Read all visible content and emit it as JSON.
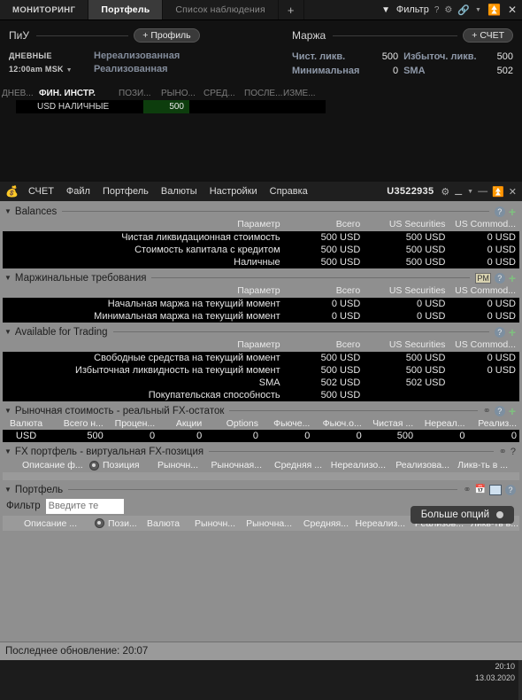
{
  "top": {
    "tabs": [
      {
        "label": "МОНИТОРИНГ",
        "state": "normal"
      },
      {
        "label": "Портфель",
        "state": "active"
      },
      {
        "label": "Список наблюдения",
        "state": "dim"
      },
      {
        "label": "+",
        "state": "plus"
      }
    ],
    "toolbar": {
      "filter_label": "Фильтр",
      "help_label": "?",
      "gear_icon": "gear-icon",
      "link_icon": "link-icon",
      "caret_icon": "chevron-down-icon",
      "expand_icon": "expand-icon",
      "close_icon": "close-icon"
    },
    "pnl": {
      "title": "ПиУ",
      "profile_button": "+ Профиль",
      "period": "ДНЕВНЫЕ",
      "period_time": "12:00am MSK",
      "rows": [
        {
          "label": "Нереализованная",
          "value": ""
        },
        {
          "label": "Реализованная",
          "value": ""
        }
      ]
    },
    "margin": {
      "title": "Маржа",
      "account_button": "+ СЧЕТ",
      "rows": [
        {
          "label_left": "Чист. ликв.",
          "value_left": "500",
          "label_right": "Избыточ. ликв.",
          "value_right": "500"
        },
        {
          "label_left": "Минимальная",
          "value_left": "0",
          "label_right": "SMA",
          "value_right": "502"
        }
      ]
    },
    "mini_grid": {
      "headers": [
        "ДНЕВ...",
        "ФИН. ИНСТР.",
        "ПОЗИ...",
        "РЫНО...",
        "СРЕД...",
        "ПОСЛЕ...",
        "ИЗМЕ..."
      ],
      "row": {
        "instrument": "USD НАЛИЧНЫЕ",
        "position": "500"
      },
      "highlight_color": "#0d3d0d"
    }
  },
  "tws": {
    "menubar": {
      "items": [
        "СЧЕТ",
        "Файл",
        "Портфель",
        "Валюты",
        "Настройки",
        "Справка"
      ],
      "account": "U3522935",
      "gear_icon": "gear-icon",
      "pin_icon": "pin-icon",
      "minimize_icon": "minimize-icon",
      "maximize_icon": "maximize-icon",
      "close_icon": "close-icon"
    },
    "sections": {
      "balances": {
        "title": "Balances",
        "columns": [
          "Параметр",
          "Всего",
          "US Securities",
          "US Commod..."
        ],
        "rows": [
          {
            "param": "Чистая ликвидационная стоимость",
            "total": "500 USD",
            "sec": "500 USD",
            "com": "0 USD"
          },
          {
            "param": "Стоимость капитала с кредитом",
            "total": "500 USD",
            "sec": "500 USD",
            "com": "0 USD"
          },
          {
            "param": "Наличные",
            "total": "500 USD",
            "sec": "500 USD",
            "com": "0 USD"
          }
        ]
      },
      "margin_req": {
        "title": "Маржинальные требования",
        "columns": [
          "Параметр",
          "Всего",
          "US Securities",
          "US Commod..."
        ],
        "rows": [
          {
            "param": "Начальная маржа на текущий момент",
            "total": "0 USD",
            "sec": "0 USD",
            "com": "0 USD"
          },
          {
            "param": "Минимальная маржа на текущий момент",
            "total": "0 USD",
            "sec": "0 USD",
            "com": "0 USD"
          }
        ]
      },
      "available": {
        "title": "Available for Trading",
        "columns": [
          "Параметр",
          "Всего",
          "US Securities",
          "US Commod..."
        ],
        "rows": [
          {
            "param": "Свободные средства на текущий момент",
            "total": "500 USD",
            "sec": "500 USD",
            "com": "0 USD"
          },
          {
            "param": "Избыточная ликвидность на текущий момент",
            "total": "500 USD",
            "sec": "500 USD",
            "com": "0 USD"
          },
          {
            "param": "SMA",
            "total": "502 USD",
            "sec": "502 USD",
            "com": ""
          },
          {
            "param": "Покупательская способность",
            "total": "500 USD",
            "sec": "",
            "com": ""
          }
        ]
      },
      "fx_real": {
        "title": "Рыночная стоимость - реальный FX-остаток",
        "columns": [
          "Валюта",
          "Всего н...",
          "Процен...",
          "Акции",
          "Options",
          "Фьюче...",
          "Фьюч.о...",
          "Чистая ...",
          "Нереал...",
          "Реализ..."
        ],
        "rows": [
          {
            "cur": "USD",
            "c1": "500",
            "c2": "0",
            "c3": "0",
            "c4": "0",
            "c5": "0",
            "c6": "0",
            "c7": "500",
            "c8": "0",
            "c9": "0"
          }
        ]
      },
      "fx_virtual": {
        "title": "FX портфель - виртуальная FX-позиция",
        "help_label": "?",
        "columns": [
          "Описание ф...",
          "Позиция",
          "Рыночн...",
          "Рыночная...",
          "Средняя ...",
          "Нереализо...",
          "Реализова...",
          "Ликв-ть в ..."
        ]
      },
      "portfolio": {
        "title": "Портфель",
        "filter_label": "Фильтр",
        "filter_value": "",
        "filter_placeholder": "Введите те",
        "more_options_button": "Больше опций",
        "columns": [
          "Описание ...",
          "Пози...",
          "Валюта",
          "Рыночн...",
          "Рыночна...",
          "Средняя...",
          "Нереализ...",
          "Реализов...",
          "Ликв-ть в..."
        ]
      }
    },
    "statusbar": {
      "text": "Последнее обновление: 20:07"
    }
  },
  "clock": {
    "time": "20:10",
    "date": "13.03.2020"
  }
}
